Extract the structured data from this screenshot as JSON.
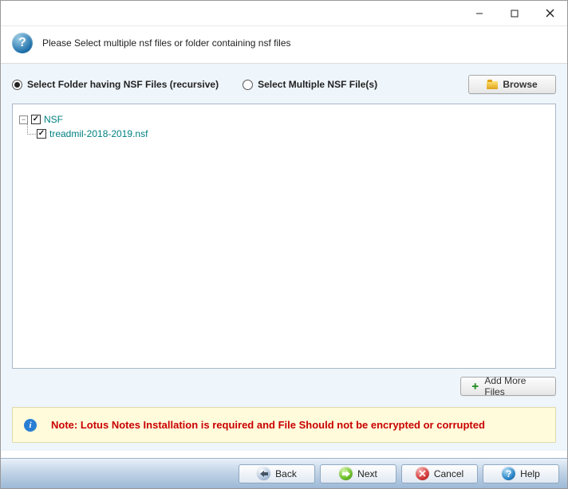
{
  "header": {
    "instruction": "Please Select multiple nsf files or folder containing nsf files"
  },
  "options": {
    "radio_folder": "Select Folder having NSF Files (recursive)",
    "radio_files": "Select Multiple NSF File(s)",
    "browse_label": "Browse"
  },
  "tree": {
    "root_label": "NSF",
    "child_label": "treadmil-2018-2019.nsf"
  },
  "add_more_label": "Add More Files",
  "note": {
    "text": "Note: Lotus Notes Installation is required and File Should not be encrypted or corrupted"
  },
  "footer": {
    "back": "Back",
    "next": "Next",
    "cancel": "Cancel",
    "help": "Help"
  }
}
